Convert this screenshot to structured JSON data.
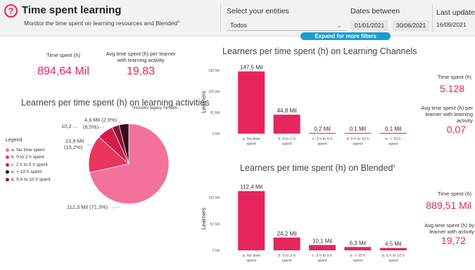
{
  "header": {
    "title": "Time spent learning",
    "subtitle_prefix": "Monitor the time spent on learning resources and ",
    "subtitle_emph": "Blended",
    "subtitle_suffix": "x."
  },
  "filters": {
    "entities_label": "Select your entities",
    "entities_value": "Todos",
    "dates_label": "Dates between",
    "date_from": "01/01/2021",
    "date_to": "30/06/2021",
    "expand_label": "Expand for more filters",
    "last_update_label": "Last update",
    "last_update_value": "16/09/2021"
  },
  "kpis": {
    "time_spent_label": "Time spent (h)",
    "time_spent_value": "894,64 Mil",
    "avg_label": "Avg time spent (h) per learner with learning activity",
    "avg_value": "19,83"
  },
  "pie": {
    "title": "Learners per time spent (h) on learning activities",
    "note": "*includes legacy formats",
    "legend_title": "Legend",
    "legend": [
      {
        "label": "a. No time spent",
        "color": "#f2729a"
      },
      {
        "label": "b. 0 to 2 h spent",
        "color": "#e8365f"
      },
      {
        "label": "c. 2 h to 5 h spent",
        "color": "#d21d4a"
      },
      {
        "label": "e. > 10 h spent",
        "color": "#3a0a1a"
      },
      {
        "label": "d. 5 h to 10 h spent",
        "color": "#8c1535"
      }
    ],
    "labels": {
      "a": "112,3 Mil (71,3%)",
      "b1": "23,9 Mil",
      "b2": "(15,2%)",
      "c1": "10,2 ...",
      "c2": "(6,5%)",
      "d": "4,6 Mil (2,9%)"
    }
  },
  "channels": {
    "title": "Learners per time spent (h) on Learning Channels",
    "time_label": "Time spent (h)",
    "time_value": "5.128",
    "avg_label": "Avg time spent (h) per learner with learning activity",
    "avg_value": "0,07"
  },
  "blended": {
    "title": "Learners per time spent (h) on Blended",
    "title_suffix": "x",
    "time_label": "Time spent (h)",
    "time_value": "889,51 Mil",
    "avg_label": "Avg time spent (h) by learner with activity",
    "avg_value": "19,72"
  },
  "chart_data": [
    {
      "type": "pie",
      "title": "Learners per time spent (h) on learning activities",
      "categories": [
        "a. No time spent",
        "b. 0 to 2 h spent",
        "c. 2 h to 5 h spent",
        "d. 5 h to 10 h spent",
        "e. > 10 h spent"
      ],
      "values": [
        112.3,
        23.9,
        10.2,
        4.6,
        6.1
      ],
      "percent": [
        71.3,
        15.2,
        6.5,
        2.9,
        4.1
      ],
      "legend_position": "left"
    },
    {
      "type": "bar",
      "title": "Learners per time spent (h) on Learning Channels",
      "ylabel": "Learners",
      "categories": [
        "a. No time spent",
        "b. 0 to 2 h spent",
        "c. 2 h to 5 h spent",
        "d. 5 h to 10 h spent",
        "e. > 10 h spent"
      ],
      "values": [
        147.5,
        44.8,
        0.2,
        0.1,
        0.1
      ],
      "data_labels": [
        "147,5 Mil",
        "44,8 Mil",
        "0,2 Mil",
        "0,1 Mil",
        "0,1 Mil"
      ],
      "yticks": [
        "150 Mil",
        "100 Mil",
        "50 Mil",
        "0 Mil"
      ],
      "ylim": [
        0,
        150
      ],
      "color": "#e8245c"
    },
    {
      "type": "bar",
      "title": "Learners per time spent (h) on Blended",
      "ylabel": "Learners",
      "categories": [
        "a. No time spent",
        "b. 0 to 2 h spent",
        "c. 2 h to 5 h spent",
        "e. > 10 h spent",
        "d. 5 h to 10 h spent"
      ],
      "values": [
        112.4,
        24.2,
        10.1,
        6.3,
        4.5
      ],
      "data_labels": [
        "112,4 Mil",
        "24,2 Mil",
        "10,1 Mil",
        "6,3 Mil",
        "4,5 Mil"
      ],
      "yticks": [
        "100 Mil",
        "50 Mil",
        "0 Mil"
      ],
      "ylim": [
        0,
        120
      ],
      "color": "#e8245c"
    }
  ]
}
